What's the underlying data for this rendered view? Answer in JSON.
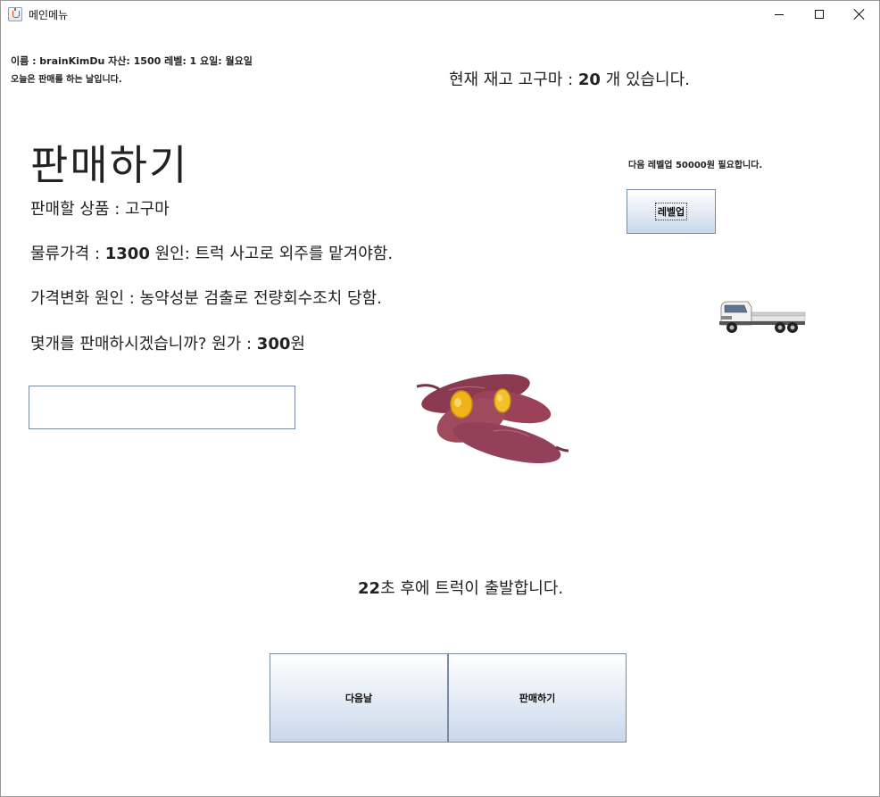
{
  "window": {
    "title": "메인메뉴"
  },
  "status": {
    "info_line": "이름 : brainKimDu    자산: 1500    레벨: 1    요일: 월요일",
    "day_notice": "오늘은 판매를 하는 날입니다."
  },
  "stock": {
    "prefix": "현재 재고 고구마 : ",
    "count": "20",
    "suffix": " 개 있습니다."
  },
  "main": {
    "title": "판매하기",
    "product": "판매할 상품 : 고구마",
    "logistics_prefix": "물류가격 : ",
    "logistics_price": "1300",
    "logistics_suffix": " 원인: 트럭 사고로 외주를 맡겨야함.",
    "price_change": "가격변화 원인 : 농약성분 검출로 전량회수조치 당함.",
    "question_prefix": "몇개를 판매하시겠습니까? 원가 : ",
    "cost": "300",
    "question_suffix": "원"
  },
  "levelup": {
    "note": "다음 레벨업 50000원 필요합니다.",
    "button_label": "레벨업"
  },
  "quantity_input": {
    "value": "",
    "placeholder": ""
  },
  "timer": {
    "seconds": "22",
    "text": "초 후에 트럭이 출발합니다."
  },
  "buttons": {
    "next_day": "다음날",
    "sell": "판매하기"
  },
  "icons": [
    "java-app-icon",
    "minimize-icon",
    "maximize-icon",
    "close-icon",
    "truck-image",
    "sweet-potato-image"
  ]
}
